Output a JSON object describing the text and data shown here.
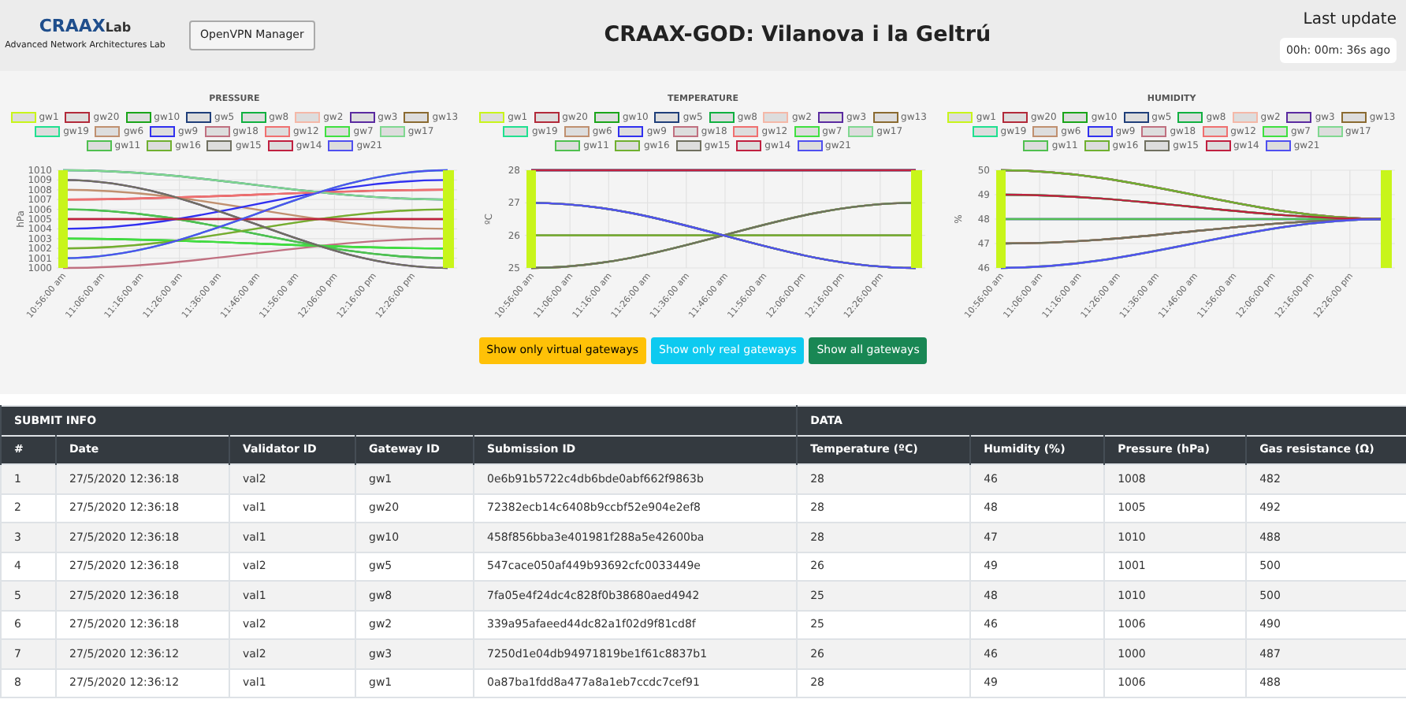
{
  "header": {
    "logo_main": "CRAAX",
    "logo_suffix": "Lab",
    "lab_name": "Advanced Network Architectures Lab",
    "vpn_button": "OpenVPN Manager",
    "title": "CRAAX-GOD: Vilanova i la Geltrú",
    "last_update_label": "Last update",
    "last_update_value": "00h: 00m: 36s ago"
  },
  "charts": [
    {
      "title": "PRESSURE",
      "ylabel": "hPa",
      "yticks": [
        "1010",
        "1009",
        "1008",
        "1007",
        "1006",
        "1005",
        "1004",
        "1003",
        "1002",
        "1001",
        "1000"
      ],
      "xticks": [
        "10:56:00 am",
        "11:06:00 am",
        "11:16:00 am",
        "11:26:00 am",
        "11:36:00 am",
        "11:46:00 am",
        "11:56:00 am",
        "12:06:00 pm",
        "12:16:00 pm",
        "12:26:00 pm"
      ],
      "legend": [
        {
          "label": "gw1",
          "color": "#c8f51a"
        },
        {
          "label": "gw20",
          "color": "#b22a3a"
        },
        {
          "label": "gw10",
          "color": "#1aa51a"
        },
        {
          "label": "gw5",
          "color": "#1f3f7a"
        },
        {
          "label": "gw8",
          "color": "#10b040"
        },
        {
          "label": "gw2",
          "color": "#f5b8a8"
        },
        {
          "label": "gw3",
          "color": "#5a2aa0"
        },
        {
          "label": "gw13",
          "color": "#8a6a30"
        },
        {
          "label": "gw19",
          "color": "#20e090"
        },
        {
          "label": "gw6",
          "color": "#c09070"
        },
        {
          "label": "gw9",
          "color": "#3030f0"
        },
        {
          "label": "gw18",
          "color": "#c07080"
        },
        {
          "label": "gw12",
          "color": "#f07070"
        },
        {
          "label": "gw7",
          "color": "#40e040"
        },
        {
          "label": "gw17",
          "color": "#80d890"
        },
        {
          "label": "gw11",
          "color": "#50c050"
        },
        {
          "label": "gw16",
          "color": "#70b030"
        },
        {
          "label": "gw15",
          "color": "#707060"
        },
        {
          "label": "gw14",
          "color": "#c02040"
        },
        {
          "label": "gw21",
          "color": "#5050f0"
        }
      ]
    },
    {
      "title": "TEMPERATURE",
      "ylabel": "ºC",
      "yticks": [
        "28",
        "27",
        "26",
        "25"
      ],
      "xticks": [
        "10:56:00 am",
        "11:06:00 am",
        "11:16:00 am",
        "11:26:00 am",
        "11:36:00 am",
        "11:46:00 am",
        "11:56:00 am",
        "12:06:00 pm",
        "12:16:00 pm",
        "12:26:00 pm"
      ],
      "legend": [
        {
          "label": "gw1",
          "color": "#c8f51a"
        },
        {
          "label": "gw20",
          "color": "#b22a3a"
        },
        {
          "label": "gw10",
          "color": "#1aa51a"
        },
        {
          "label": "gw5",
          "color": "#1f3f7a"
        },
        {
          "label": "gw8",
          "color": "#10b040"
        },
        {
          "label": "gw2",
          "color": "#f5b8a8"
        },
        {
          "label": "gw3",
          "color": "#5a2aa0"
        },
        {
          "label": "gw13",
          "color": "#8a6a30"
        },
        {
          "label": "gw19",
          "color": "#20e090"
        },
        {
          "label": "gw6",
          "color": "#c09070"
        },
        {
          "label": "gw9",
          "color": "#3030f0"
        },
        {
          "label": "gw18",
          "color": "#c07080"
        },
        {
          "label": "gw12",
          "color": "#f07070"
        },
        {
          "label": "gw7",
          "color": "#40e040"
        },
        {
          "label": "gw17",
          "color": "#80d890"
        },
        {
          "label": "gw11",
          "color": "#50c050"
        },
        {
          "label": "gw16",
          "color": "#70b030"
        },
        {
          "label": "gw15",
          "color": "#707060"
        },
        {
          "label": "gw14",
          "color": "#c02040"
        },
        {
          "label": "gw21",
          "color": "#5050f0"
        }
      ]
    },
    {
      "title": "HUMIDITY",
      "ylabel": "%",
      "yticks": [
        "50",
        "49",
        "48",
        "47",
        "46"
      ],
      "xticks": [
        "10:56:00 am",
        "11:06:00 am",
        "11:16:00 am",
        "11:26:00 am",
        "11:36:00 am",
        "11:46:00 am",
        "11:56:00 am",
        "12:06:00 pm",
        "12:16:00 pm",
        "12:26:00 pm"
      ],
      "legend": [
        {
          "label": "gw1",
          "color": "#c8f51a"
        },
        {
          "label": "gw20",
          "color": "#b22a3a"
        },
        {
          "label": "gw10",
          "color": "#1aa51a"
        },
        {
          "label": "gw5",
          "color": "#1f3f7a"
        },
        {
          "label": "gw8",
          "color": "#10b040"
        },
        {
          "label": "gw2",
          "color": "#f5b8a8"
        },
        {
          "label": "gw3",
          "color": "#5a2aa0"
        },
        {
          "label": "gw13",
          "color": "#8a6a30"
        },
        {
          "label": "gw19",
          "color": "#20e090"
        },
        {
          "label": "gw6",
          "color": "#c09070"
        },
        {
          "label": "gw9",
          "color": "#3030f0"
        },
        {
          "label": "gw18",
          "color": "#c07080"
        },
        {
          "label": "gw12",
          "color": "#f07070"
        },
        {
          "label": "gw7",
          "color": "#40e040"
        },
        {
          "label": "gw17",
          "color": "#80d890"
        },
        {
          "label": "gw11",
          "color": "#50c050"
        },
        {
          "label": "gw16",
          "color": "#70b030"
        },
        {
          "label": "gw15",
          "color": "#707060"
        },
        {
          "label": "gw14",
          "color": "#c02040"
        },
        {
          "label": "gw21",
          "color": "#5050f0"
        }
      ]
    }
  ],
  "filter_buttons": [
    {
      "label": "Show only virtual gateways",
      "kind": "virtual"
    },
    {
      "label": "Show only real gateways",
      "kind": "real"
    },
    {
      "label": "Show all gateways",
      "kind": "all"
    }
  ],
  "table": {
    "groups": [
      {
        "label": "SUBMIT INFO",
        "columns": [
          "#",
          "Date",
          "Validator ID",
          "Gateway ID",
          "Submission ID"
        ]
      },
      {
        "label": "DATA",
        "columns": [
          "Temperature (ºC)",
          "Humidity (%)",
          "Pressure (hPa)",
          "Gas resistance (Ω)"
        ]
      }
    ],
    "rows": [
      [
        "1",
        "27/5/2020 12:36:18",
        "val2",
        "gw1",
        "0e6b91b5722c4db6bde0abf662f9863b",
        "28",
        "46",
        "1008",
        "482"
      ],
      [
        "2",
        "27/5/2020 12:36:18",
        "val1",
        "gw20",
        "72382ecb14c6408b9ccbf52e904e2ef8",
        "28",
        "48",
        "1005",
        "492"
      ],
      [
        "3",
        "27/5/2020 12:36:18",
        "val1",
        "gw10",
        "458f856bba3e401981f288a5e42600ba",
        "28",
        "47",
        "1010",
        "488"
      ],
      [
        "4",
        "27/5/2020 12:36:18",
        "val2",
        "gw5",
        "547cace050af449b93692cfc0033449e",
        "26",
        "49",
        "1001",
        "500"
      ],
      [
        "5",
        "27/5/2020 12:36:18",
        "val1",
        "gw8",
        "7fa05e4f24dc4c828f0b38680aed4942",
        "25",
        "48",
        "1010",
        "500"
      ],
      [
        "6",
        "27/5/2020 12:36:18",
        "val2",
        "gw2",
        "339a95afaeed44dc82a1f02d9f81cd8f",
        "25",
        "46",
        "1006",
        "490"
      ],
      [
        "7",
        "27/5/2020 12:36:12",
        "val2",
        "gw3",
        "7250d1e04db94971819be1f61c8837b1",
        "26",
        "46",
        "1000",
        "487"
      ],
      [
        "8",
        "27/5/2020 12:36:12",
        "val1",
        "gw1",
        "0a87ba1fdd8a477a8a1eb7ccdc7cef91",
        "28",
        "49",
        "1006",
        "488"
      ]
    ]
  }
}
